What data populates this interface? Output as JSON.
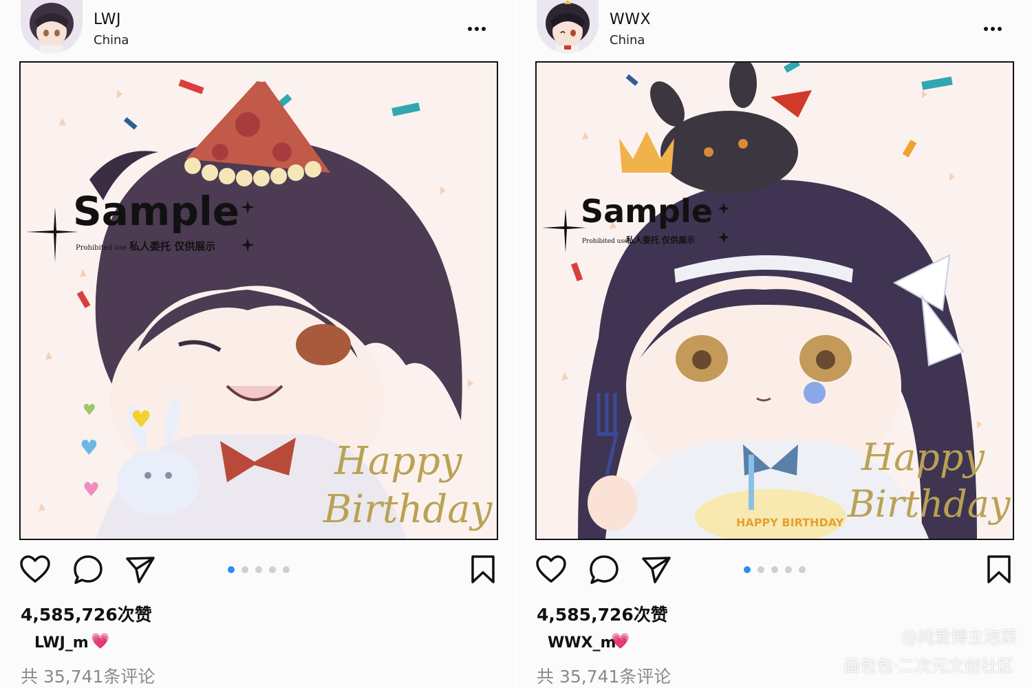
{
  "posts": [
    {
      "username": "LWJ",
      "location": "China",
      "more": "•••",
      "likes": "4,585,726次赞",
      "caption_user": "LWJ_m",
      "caption_emoji": "💗",
      "comments": "共 35,741条评论",
      "carousel": {
        "count": 5,
        "active": 1
      },
      "image_text": {
        "sample": "Sample",
        "sample_sub": "Prohibited use",
        "sample_sub_cn": "私人委托 仅供展示",
        "happy": "Happy",
        "birthday": "Birthday"
      }
    },
    {
      "username": "WWX",
      "location": "China",
      "more": "•••",
      "likes": "4,585,726次赞",
      "caption_user": "WWX_m",
      "caption_emoji": "💗",
      "comments": "共 35,741条评论",
      "carousel": {
        "count": 5,
        "active": 1
      },
      "image_text": {
        "sample": "Sample",
        "sample_sub": "Prohibited use",
        "sample_sub_cn": "私人委托 仅供展示",
        "happy": "Happy",
        "birthday": "Birthday",
        "cake_text": "HAPPY BIRTHDAY"
      }
    }
  ],
  "watermark": {
    "line1": "@纯爱博主泡菜",
    "line2": "画包包·二次元文创社区"
  },
  "colors": {
    "accent": "#2a8ef0",
    "dot_inactive": "#cfcfcf",
    "text": "#111111",
    "muted": "#8a8a8a",
    "gold": "#b9a253"
  }
}
